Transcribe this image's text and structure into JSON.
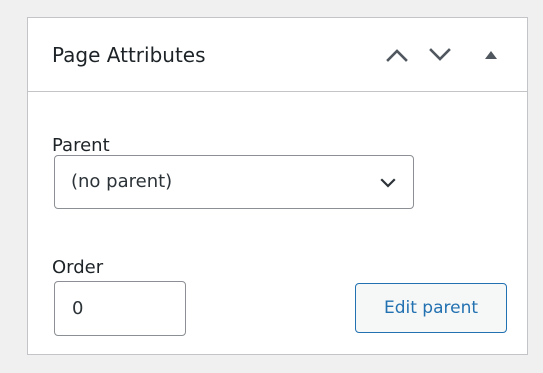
{
  "panel": {
    "title": "Page Attributes",
    "controls": {
      "move_up_icon": "chevron-up-icon",
      "move_down_icon": "chevron-down-icon",
      "toggle_icon": "triangle-up-icon"
    }
  },
  "parent": {
    "label": "Parent",
    "selected": "(no parent)",
    "chevron_icon": "chevron-down-icon"
  },
  "order": {
    "label": "Order",
    "value": "0"
  },
  "actions": {
    "edit_parent_label": "Edit parent"
  },
  "colors": {
    "background": "#f0f0f1",
    "panel_border": "#c3c4c7",
    "text": "#1d2327",
    "accent": "#2271b1",
    "icon": "#50575e"
  }
}
